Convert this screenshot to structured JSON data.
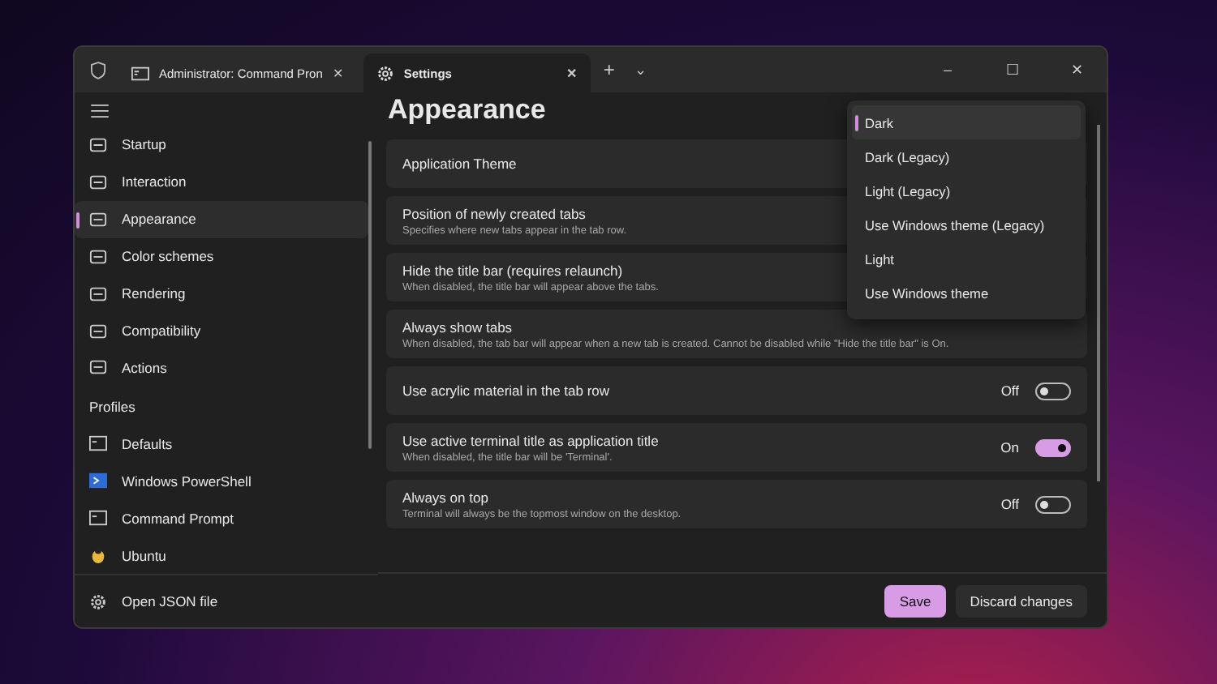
{
  "window": {
    "tabs": [
      {
        "label": "Administrator: Command Pron",
        "selected": false,
        "close": "✕"
      },
      {
        "label": "Settings",
        "selected": true,
        "close": "✕"
      }
    ],
    "new_tab": "+",
    "tab_menu": "⌄",
    "controls": [
      "–",
      "☐",
      "✕"
    ]
  },
  "sidebar": {
    "items": [
      {
        "label": "Startup",
        "selected": false
      },
      {
        "label": "Interaction",
        "selected": false
      },
      {
        "label": "Appearance",
        "selected": true
      },
      {
        "label": "Color schemes",
        "selected": false
      },
      {
        "label": "Rendering",
        "selected": false
      },
      {
        "label": "Compatibility",
        "selected": false
      },
      {
        "label": "Actions",
        "selected": false
      }
    ],
    "profiles_header": "Profiles",
    "profiles": [
      {
        "label": "Defaults",
        "selected": false
      },
      {
        "label": "Windows PowerShell",
        "selected": false
      },
      {
        "label": "Command Prompt",
        "selected": false
      },
      {
        "label": "Ubuntu",
        "selected": false
      }
    ],
    "footer_item": "Open JSON file"
  },
  "page": {
    "title": "Appearance",
    "settings": [
      {
        "label": "Application Theme"
      },
      {
        "label": "Position of newly created tabs",
        "description": "Specifies where new tabs appear in the tab row."
      },
      {
        "label": "Hide the title bar (requires relaunch)",
        "description": "When disabled, the title bar will appear above the tabs."
      },
      {
        "label": "Always show tabs",
        "description": "When disabled, the tab bar will appear when a new tab is created. Cannot be disabled while \"Hide the title bar\" is On."
      },
      {
        "label": "Use acrylic material in the tab row",
        "toggle": {
          "on": false,
          "text": "Off"
        }
      },
      {
        "label": "Use active terminal title as application title",
        "description": "When disabled, the title bar will be 'Terminal'.",
        "toggle": {
          "on": true,
          "text": "On"
        }
      },
      {
        "label": "Always on top",
        "description": "Terminal will always be the topmost window on the desktop.",
        "toggle": {
          "on": false,
          "text": "Off"
        }
      }
    ],
    "theme_dropdown": [
      {
        "label": "Dark",
        "selected": true
      },
      {
        "label": "Dark (Legacy)",
        "selected": false
      },
      {
        "label": "Light (Legacy)",
        "selected": false
      },
      {
        "label": "Use Windows theme (Legacy)",
        "selected": false
      },
      {
        "label": "Light",
        "selected": false
      },
      {
        "label": "Use Windows theme",
        "selected": false
      }
    ]
  },
  "footer": {
    "save": "Save",
    "discard": "Discard changes"
  }
}
